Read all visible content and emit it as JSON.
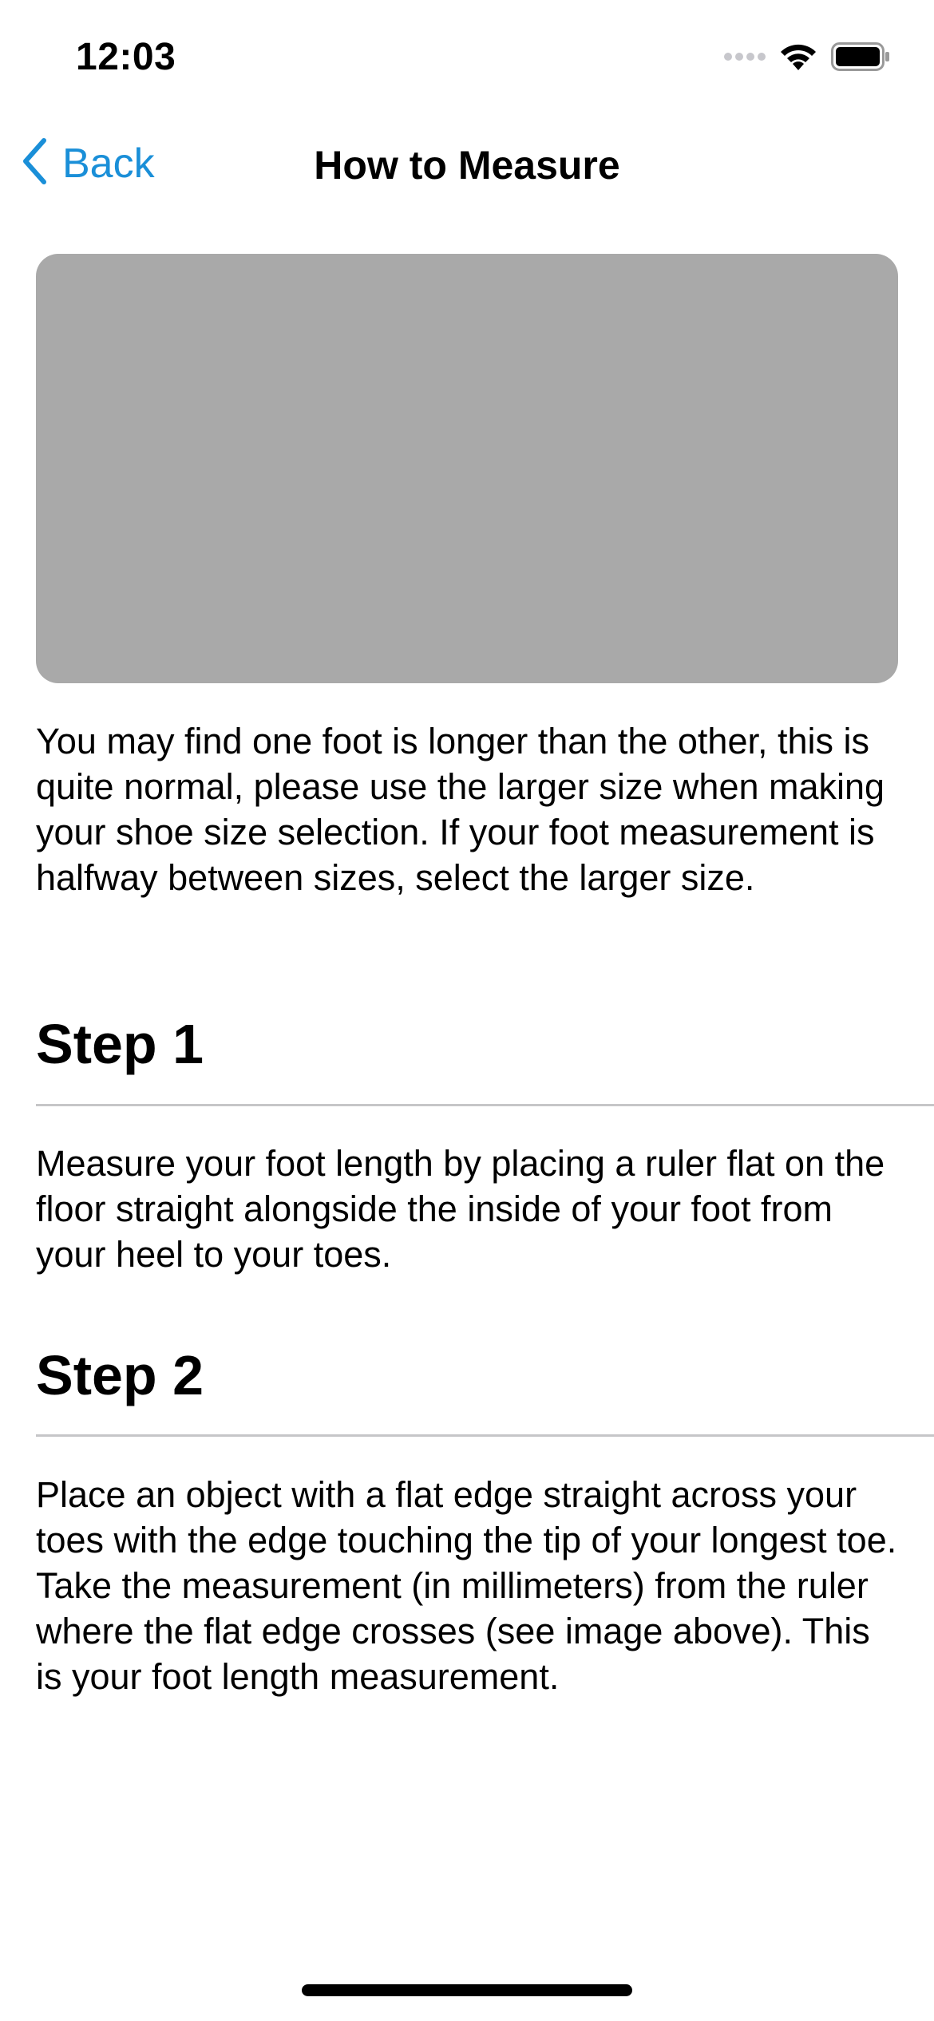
{
  "status_bar": {
    "time": "12:03",
    "icons": [
      "signal-icon",
      "wifi-icon",
      "battery-icon"
    ]
  },
  "nav": {
    "back_label": "Back",
    "title": "How to Measure",
    "accent_color": "#1a8fd8"
  },
  "content": {
    "image_color": "#a9a9a9",
    "intro": "You may find one foot is longer than the other, this is quite normal, please use the larger size when making your shoe size selection. If your foot measurement is halfway between sizes, select the larger size.",
    "steps": [
      {
        "heading": "Step 1",
        "body": "Measure your foot length by placing a ruler flat on the floor straight alongside the inside of your foot from your heel to your toes."
      },
      {
        "heading": "Step 2",
        "body": "Place an object with a flat edge straight across your toes with the edge touching the tip of your longest toe. Take the measurement (in millimeters) from the ruler where the flat edge crosses (see image above). This is your foot length measurement."
      }
    ]
  }
}
